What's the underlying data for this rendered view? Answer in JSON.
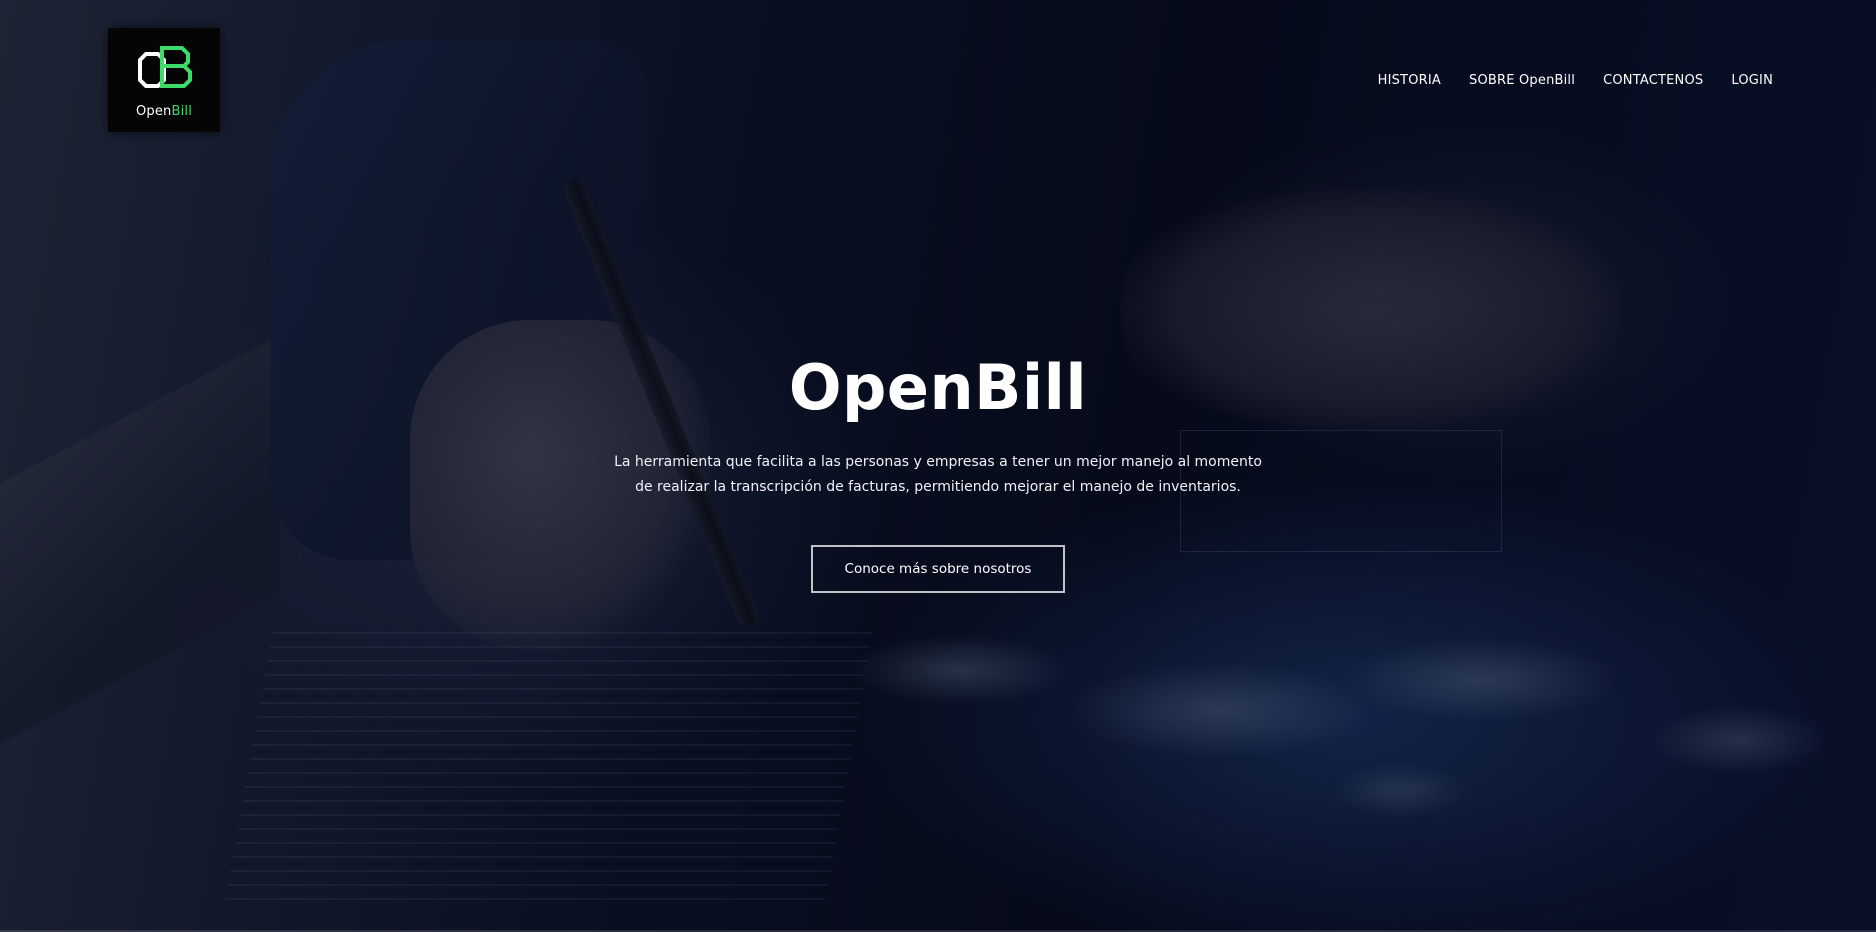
{
  "brand": {
    "name_part1": "Open",
    "name_part2": "Bill",
    "logo_icon": "ob-monogram-icon",
    "accent_color": "#3ddc6a"
  },
  "nav": {
    "items": [
      {
        "label": "HISTORIA"
      },
      {
        "label": "SOBRE OpenBill"
      },
      {
        "label": "CONTACTENOS"
      },
      {
        "label": "LOGIN"
      }
    ]
  },
  "hero": {
    "title": "OpenBill",
    "subtitle_line1": "La herramienta que facilita a las personas y empresas a tener un mejor manejo al momento",
    "subtitle_line2": "de realizar la transcripción de facturas, permitiendo mejorar el manejo de inventarios.",
    "cta_label": "Conoce más sobre nosotros"
  },
  "colors": {
    "background": "#0a1020",
    "text": "#ffffff"
  }
}
